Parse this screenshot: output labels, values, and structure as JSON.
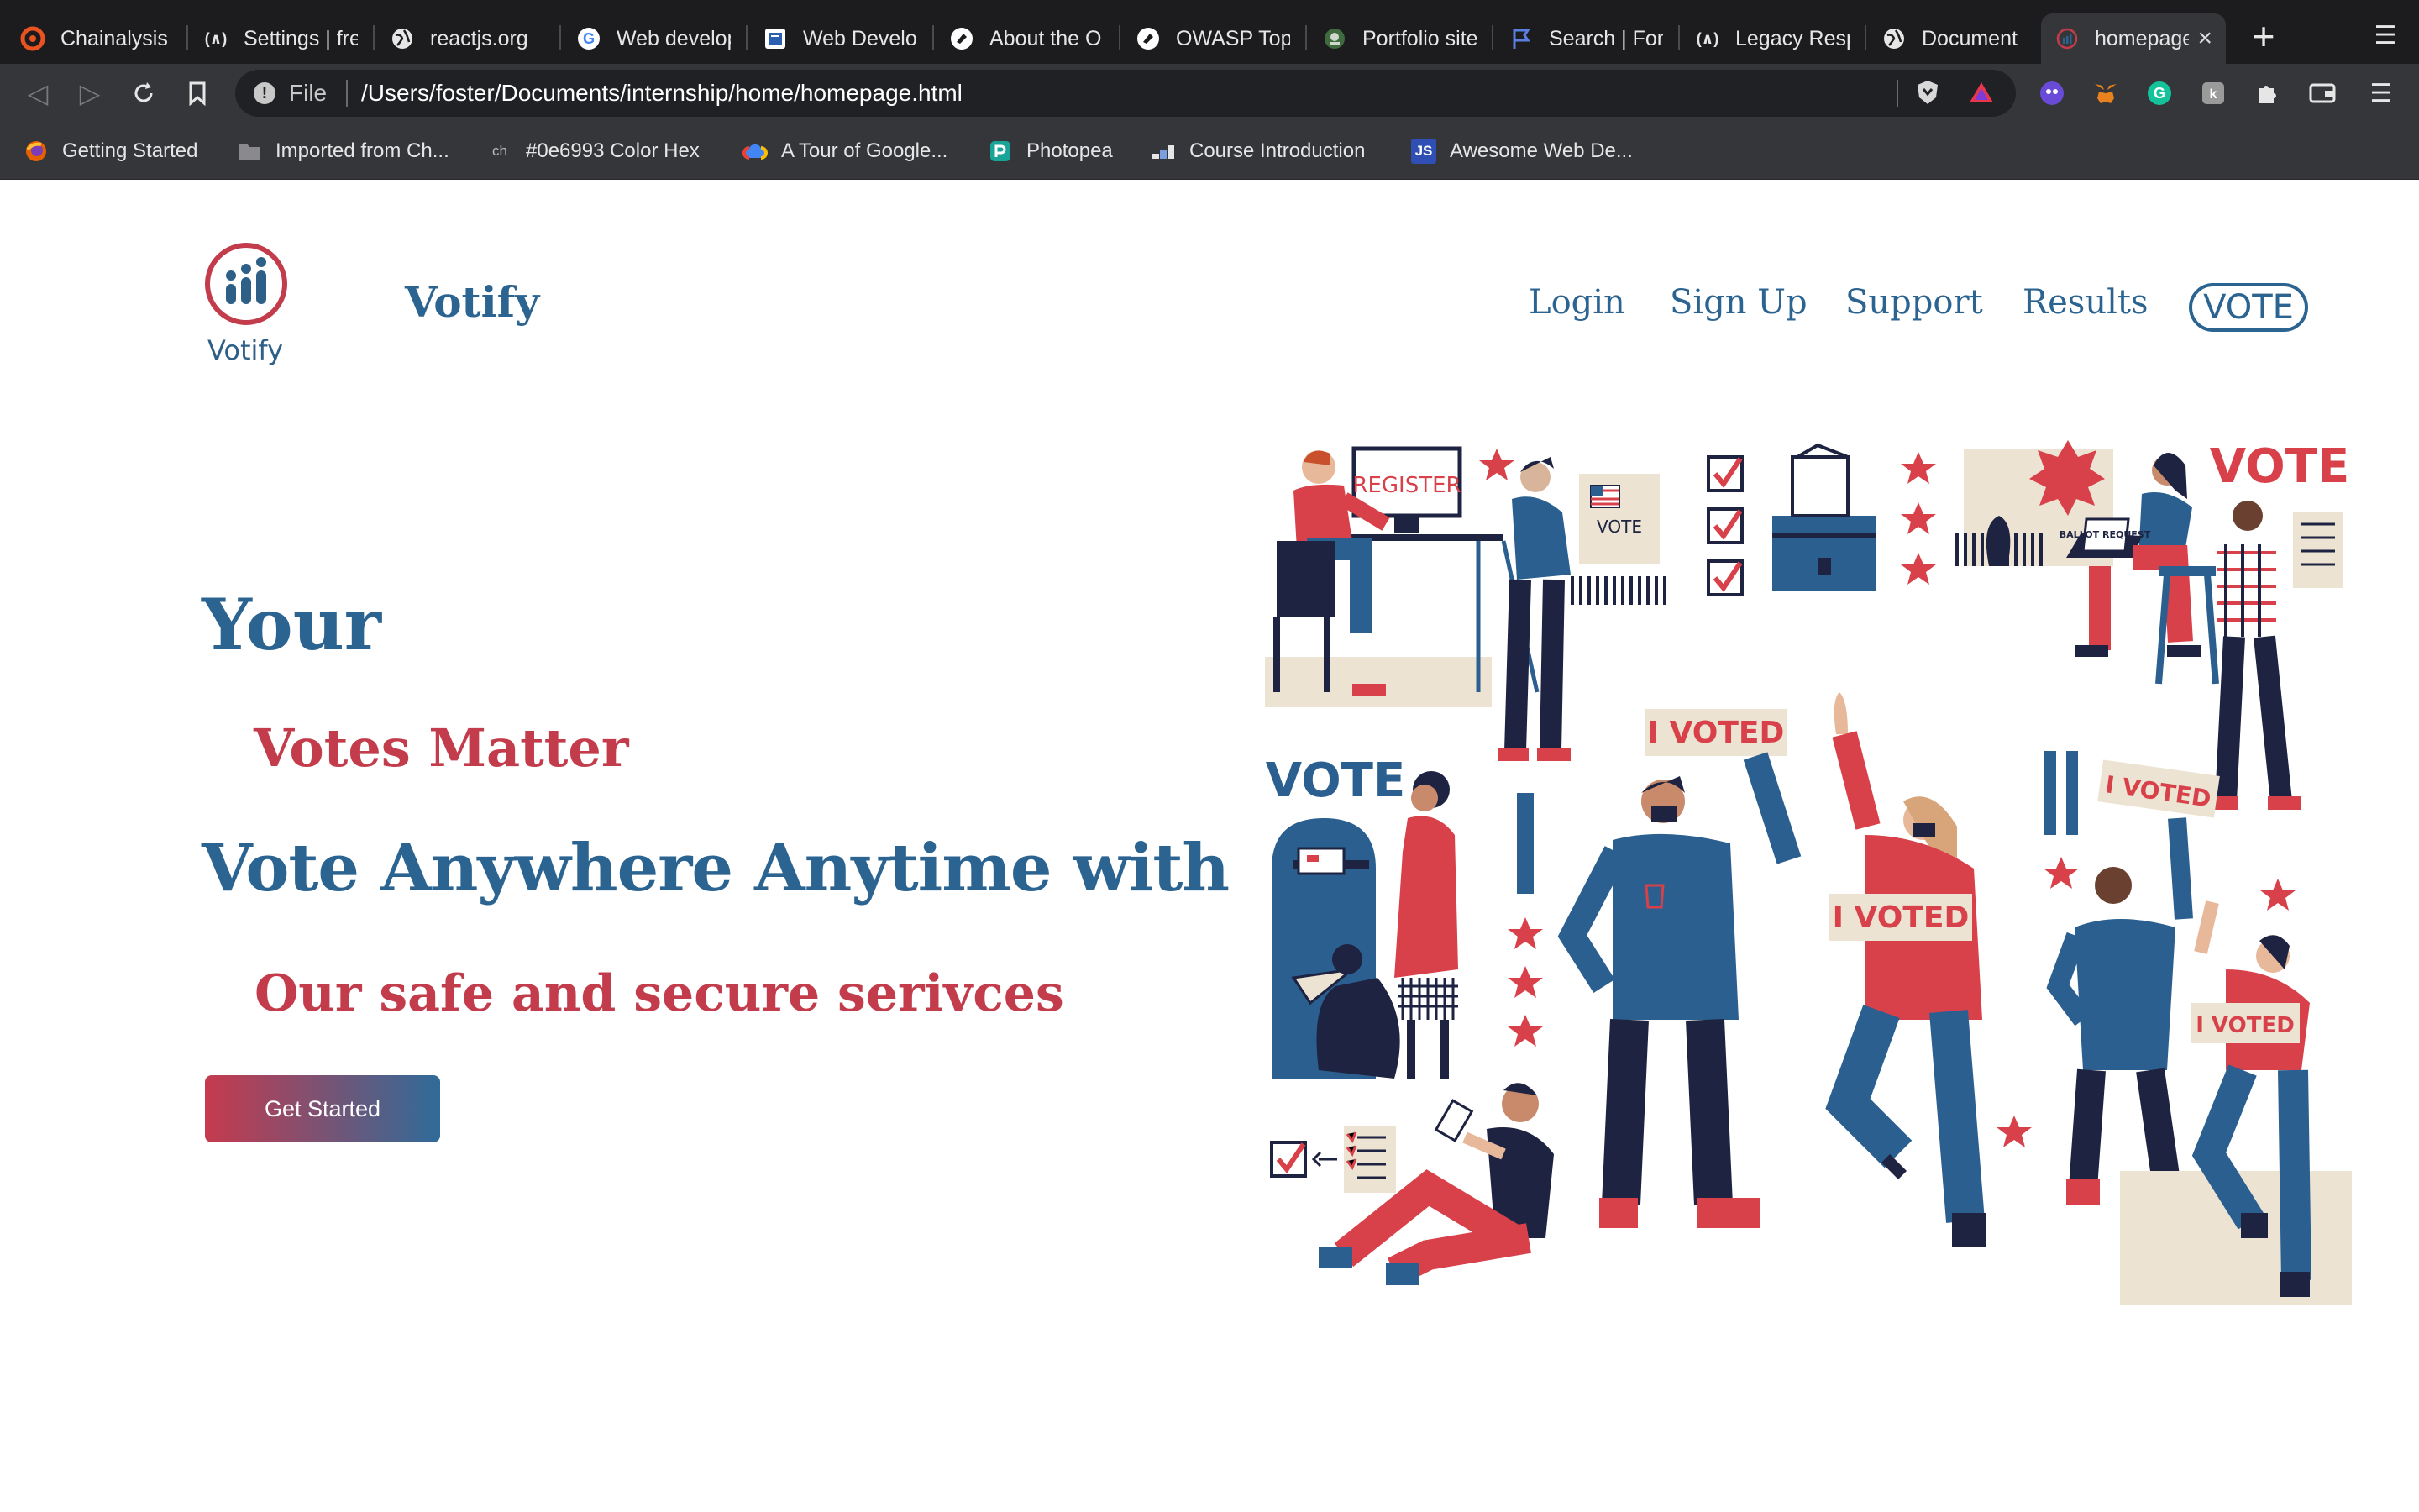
{
  "browser": {
    "tabs": [
      {
        "label": "Chainalysis C",
        "icon": "chainalysis-icon"
      },
      {
        "label": "Settings | fre",
        "icon": "freecodecamp-icon"
      },
      {
        "label": "reactjs.org",
        "icon": "globe-icon"
      },
      {
        "label": "Web develop",
        "icon": "google-icon"
      },
      {
        "label": "Web Develop",
        "icon": "book-icon"
      },
      {
        "label": "About the O",
        "icon": "owasp-icon"
      },
      {
        "label": "OWASP Top",
        "icon": "owasp-icon"
      },
      {
        "label": "Portfolio site",
        "icon": "portfolio-icon"
      },
      {
        "label": "Search | Font",
        "icon": "flag-icon"
      },
      {
        "label": "Legacy Resp",
        "icon": "freecodecamp-icon"
      },
      {
        "label": "Document",
        "icon": "globe-icon"
      },
      {
        "label": "homepage",
        "icon": "votify-icon",
        "active": true
      }
    ],
    "new_tab_symbol": "+",
    "close_symbol": "×",
    "address": {
      "scheme_label": "File",
      "url": "/Users/foster/Documents/internship/home/homepage.html"
    },
    "bookmarks": [
      {
        "label": "Getting Started",
        "icon": "firefox-icon"
      },
      {
        "label": "Imported from Ch...",
        "icon": "folder-icon"
      },
      {
        "label": "#0e6993 Color Hex",
        "icon": "colorhex-icon",
        "icon_text": "ch"
      },
      {
        "label": "A Tour of Google...",
        "icon": "google-cloud-icon"
      },
      {
        "label": "Photopea",
        "icon": "photopea-icon"
      },
      {
        "label": "Course Introduction",
        "icon": "course-icon"
      },
      {
        "label": "Awesome Web De...",
        "icon": "js-icon",
        "icon_text": "JS"
      }
    ]
  },
  "page": {
    "logo_caption": "Votify",
    "brand": "Votify",
    "nav": {
      "login": "Login",
      "signup": "Sign Up",
      "support": "Support",
      "results": "Results",
      "vote": "VOTE"
    },
    "hero": {
      "line1": "Your",
      "line2": "Votes Matter",
      "line3": "Vote Anywhere Anytime with",
      "line4": "Our safe and secure serivces",
      "cta": "Get Started"
    },
    "illustration_text": {
      "register": "REGISTER",
      "vote_small": "VOTE",
      "vote_big_right": "VOTE",
      "vote_big_left": "VOTE",
      "i_voted": "I VOTED",
      "ballot_request": "BALLOT REQUEST"
    }
  },
  "colors": {
    "brand_blue": "#2c6491",
    "brand_red": "#c33c4c",
    "tab_bar": "#1c1c1f",
    "toolbar": "#35363a"
  }
}
